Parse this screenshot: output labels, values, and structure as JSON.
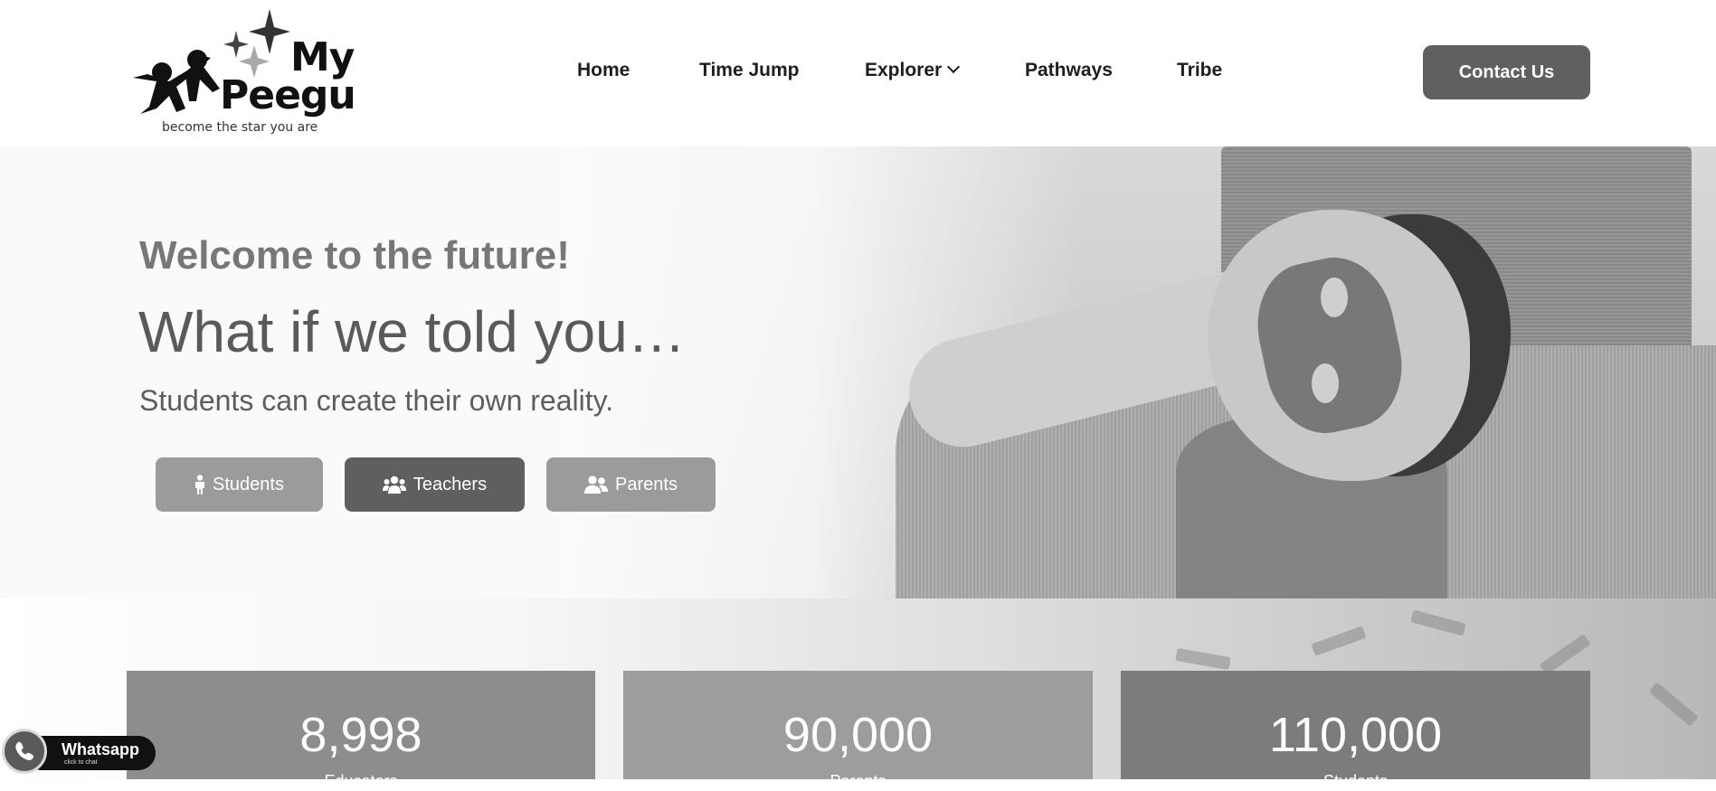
{
  "header": {
    "logo": {
      "word1": "My",
      "word2": "Peegu",
      "tagline": "become the star you are"
    },
    "nav": [
      {
        "label": "Home"
      },
      {
        "label": "Time Jump"
      },
      {
        "label": "Explorer",
        "has_dropdown": true
      },
      {
        "label": "Pathways"
      },
      {
        "label": "Tribe"
      }
    ],
    "contact_label": "Contact Us"
  },
  "hero": {
    "welcome": "Welcome to the future!",
    "headline": "What if we told you…",
    "subline": "Students can create their own reality.",
    "buttons": [
      {
        "label": "Students",
        "icon": "child-icon"
      },
      {
        "label": "Teachers",
        "icon": "users-icon"
      },
      {
        "label": "Parents",
        "icon": "user-friends-icon"
      }
    ]
  },
  "stats": [
    {
      "value": "8,998",
      "label": "Educators"
    },
    {
      "value": "90,000",
      "label": "Parents"
    },
    {
      "value": "110,000",
      "label": "Students"
    }
  ],
  "whatsapp": {
    "title": "Whatsapp",
    "subtitle": "click to chat"
  },
  "colors": {
    "contact_button": "#606060",
    "role_button_light": "#9b9b9b",
    "role_button_dark": "#5f5f5f"
  }
}
